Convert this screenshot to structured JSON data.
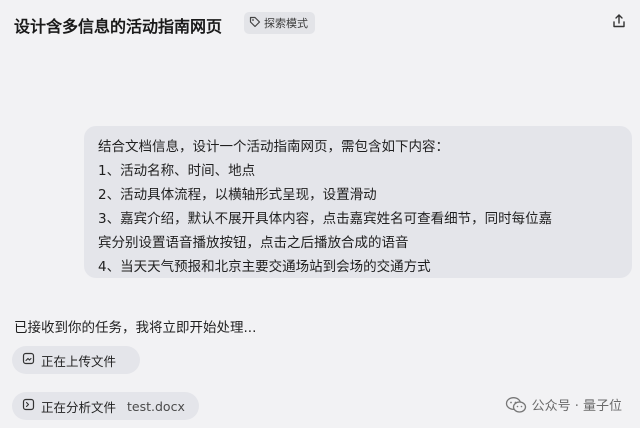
{
  "header": {
    "title": "设计含多信息的活动指南网页",
    "mode_badge": "探索模式"
  },
  "user_message": {
    "lines": [
      "结合文档信息，设计一个活动指南网页，需包含如下内容：",
      "1、活动名称、时间、地点",
      "2、活动具体流程，以横轴形式呈现，设置滑动",
      "3、嘉宾介绍，默认不展开具体内容，点击嘉宾姓名可查看细节，同时每位嘉",
      "宾分别设置语音播放按钮，点击之后播放合成的语音",
      "4、当天天气预报和北京主要交通场站到会场的交通方式"
    ]
  },
  "assistant": {
    "ack": "已接收到你的任务，我将立即开始处理...",
    "steps": [
      {
        "label": "正在上传文件",
        "file": ""
      },
      {
        "label": "正在分析文件",
        "file": "test.docx"
      }
    ]
  },
  "watermark": {
    "text": "公众号 · 量子位"
  },
  "icons": {
    "badge": "tag-icon",
    "share": "share-icon",
    "step1": "file-icon",
    "step2": "file-icon",
    "watermark": "wechat-icon"
  }
}
